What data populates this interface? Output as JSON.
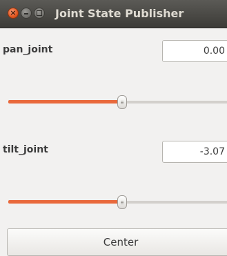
{
  "window": {
    "title": "Joint State Publisher",
    "close_glyph": "×"
  },
  "joints": [
    {
      "name": "pan_joint",
      "value": "0.00",
      "slider_fraction": 0.5
    },
    {
      "name": "tilt_joint",
      "value": "-3.07",
      "slider_fraction": 0.5
    }
  ],
  "center_button": {
    "label": "Center"
  },
  "colors": {
    "accent": "#e9693c",
    "titlebar": "#3c3b37",
    "background": "#f2f1f0"
  }
}
